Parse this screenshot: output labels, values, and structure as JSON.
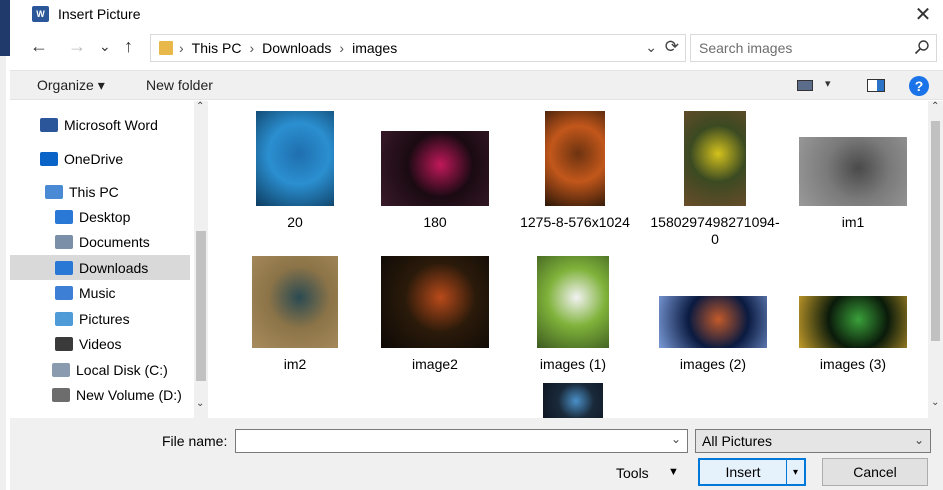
{
  "window": {
    "title": "Insert Picture",
    "app_badge": "W",
    "close_glyph": "✕"
  },
  "nav": {
    "back": "←",
    "forward": "→",
    "recent": "⌄",
    "up": "↑",
    "breadcrumb": [
      "This PC",
      "Downloads",
      "images"
    ],
    "separator": "›",
    "refresh": "⟳",
    "dropdown": "⌄"
  },
  "search": {
    "placeholder": "Search images"
  },
  "toolbar": {
    "organize": "Organize ▾",
    "new_folder": "New folder",
    "view_dropdown": "▾",
    "help": "?"
  },
  "sidebar": {
    "items": [
      {
        "label": "Microsoft Word",
        "icon": "word-icon",
        "color": "#2b579a",
        "selected": false
      },
      {
        "label": "OneDrive",
        "icon": "cloud-icon",
        "color": "#0a64c8",
        "selected": false
      },
      {
        "label": "This PC",
        "icon": "pc-icon",
        "color": "#4a8ad4",
        "selected": false
      },
      {
        "label": "Desktop",
        "icon": "desktop-icon",
        "color": "#2a78d6",
        "selected": false
      },
      {
        "label": "Documents",
        "icon": "documents-icon",
        "color": "#7b8fa8",
        "selected": false
      },
      {
        "label": "Downloads",
        "icon": "downloads-icon",
        "color": "#2a78d6",
        "selected": true
      },
      {
        "label": "Music",
        "icon": "music-icon",
        "color": "#3d7fd4",
        "selected": false
      },
      {
        "label": "Pictures",
        "icon": "pictures-icon",
        "color": "#4f9bd8",
        "selected": false
      },
      {
        "label": "Videos",
        "icon": "videos-icon",
        "color": "#3a3a3a",
        "selected": false
      },
      {
        "label": "Local Disk (C:)",
        "icon": "drive-icon",
        "color": "#8a9bb0",
        "selected": false
      },
      {
        "label": "New Volume (D:)",
        "icon": "drive-icon",
        "color": "#6d6d6d",
        "selected": false
      }
    ]
  },
  "files": [
    {
      "name": "20",
      "colors": [
        "#2b8fd0",
        "#1f6fae",
        "#0d3c60"
      ]
    },
    {
      "name": "180",
      "colors": [
        "#1a0a12",
        "#c2185b",
        "#3a1a2a"
      ]
    },
    {
      "name": "1275-8-576x1024",
      "colors": [
        "#c2571b",
        "#6d3310",
        "#2a1608"
      ]
    },
    {
      "name": "1580297498271094-0",
      "colors": [
        "#3b4a22",
        "#d4c21c",
        "#6a4c2a"
      ]
    },
    {
      "name": "im1",
      "colors": [
        "#7a7a7a",
        "#4a4a4a",
        "#9a9a9a"
      ]
    },
    {
      "name": "im2",
      "colors": [
        "#8c7448",
        "#2a4a52",
        "#a88b5c"
      ]
    },
    {
      "name": "image2",
      "colors": [
        "#2a1a0a",
        "#b84a1a",
        "#0d0906"
      ]
    },
    {
      "name": "images (1)",
      "colors": [
        "#7fb23a",
        "#f2f2f2",
        "#3c5a20"
      ]
    },
    {
      "name": "images (2)",
      "colors": [
        "#0a1a40",
        "#c25a2a",
        "#7a9ad8"
      ]
    },
    {
      "name": "images (3)",
      "colors": [
        "#0a1a0a",
        "#3aa03a",
        "#c29a2a"
      ]
    },
    {
      "name": "",
      "colors": [
        "#1a2a3a",
        "#4a90c8",
        "#0d1420"
      ]
    }
  ],
  "footer": {
    "file_name_label": "File name:",
    "file_name_value": "",
    "filter": "All Pictures",
    "tools": "Tools",
    "tools_dd": "▼",
    "insert": "Insert",
    "insert_dd": "▾",
    "cancel": "Cancel",
    "dd_glyph": "⌄"
  }
}
